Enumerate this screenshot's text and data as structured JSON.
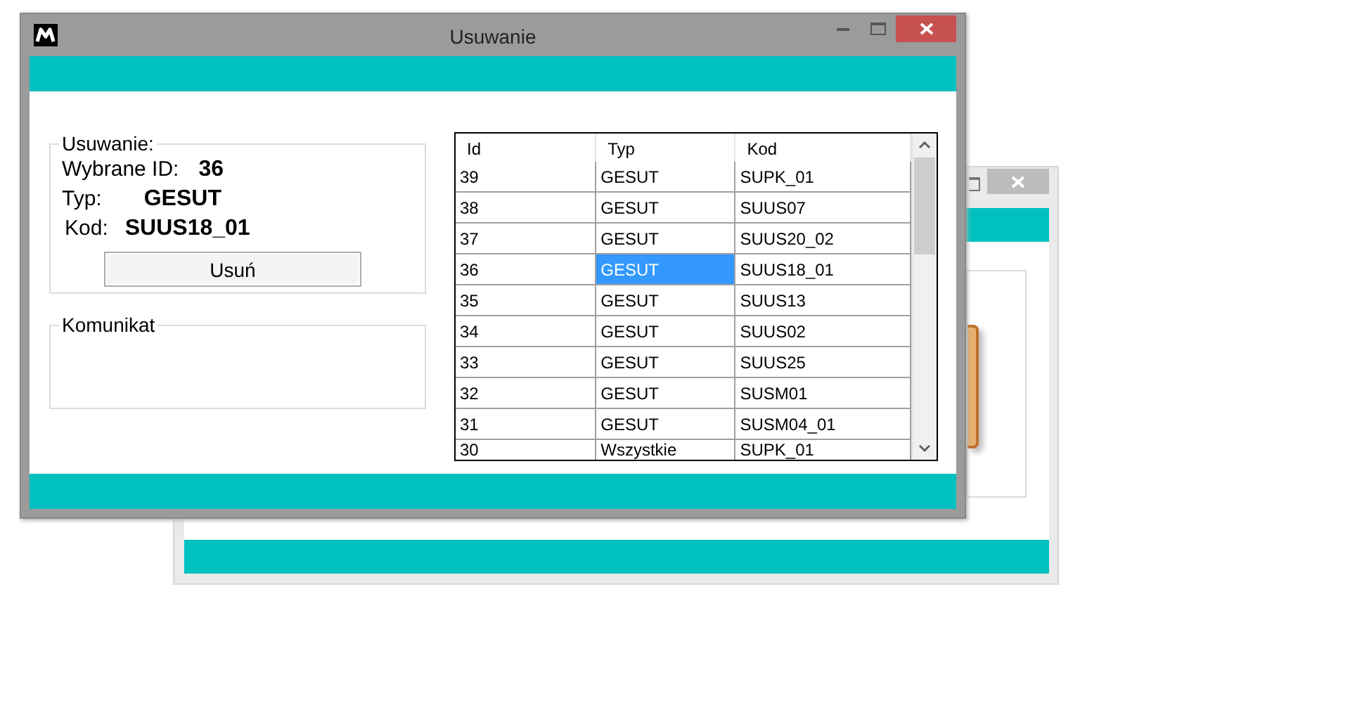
{
  "window": {
    "title": "Usuwanie"
  },
  "delete_group": {
    "title": "Usuwanie:",
    "fields": [
      {
        "label": "Wybrane ID:",
        "value": "36"
      },
      {
        "label": "Typ:",
        "value": "GESUT"
      },
      {
        "label": "Kod:",
        "value": "SUUS18_01"
      }
    ],
    "button": "Usuń"
  },
  "message_group": {
    "title": "Komunikat"
  },
  "table": {
    "columns": [
      "Id",
      "Typ",
      "Kod"
    ],
    "rows": [
      {
        "cells": [
          "39",
          "GESUT",
          "SUPK_01"
        ],
        "selected": false
      },
      {
        "cells": [
          "38",
          "GESUT",
          "SUUS07"
        ],
        "selected": false
      },
      {
        "cells": [
          "37",
          "GESUT",
          "SUUS20_02"
        ],
        "selected": false
      },
      {
        "cells": [
          "36",
          "GESUT",
          "SUUS18_01"
        ],
        "selected": true
      },
      {
        "cells": [
          "35",
          "GESUT",
          "SUUS13"
        ],
        "selected": false
      },
      {
        "cells": [
          "34",
          "GESUT",
          "SUUS02"
        ],
        "selected": false
      },
      {
        "cells": [
          "33",
          "GESUT",
          "SUUS25"
        ],
        "selected": false
      },
      {
        "cells": [
          "32",
          "GESUT",
          "SUSM01"
        ],
        "selected": false
      },
      {
        "cells": [
          "31",
          "GESUT",
          "SUSM04_01"
        ],
        "selected": false
      },
      {
        "cells": [
          "30",
          "Wszystkie",
          "SUPK_01"
        ],
        "selected": false
      }
    ]
  }
}
